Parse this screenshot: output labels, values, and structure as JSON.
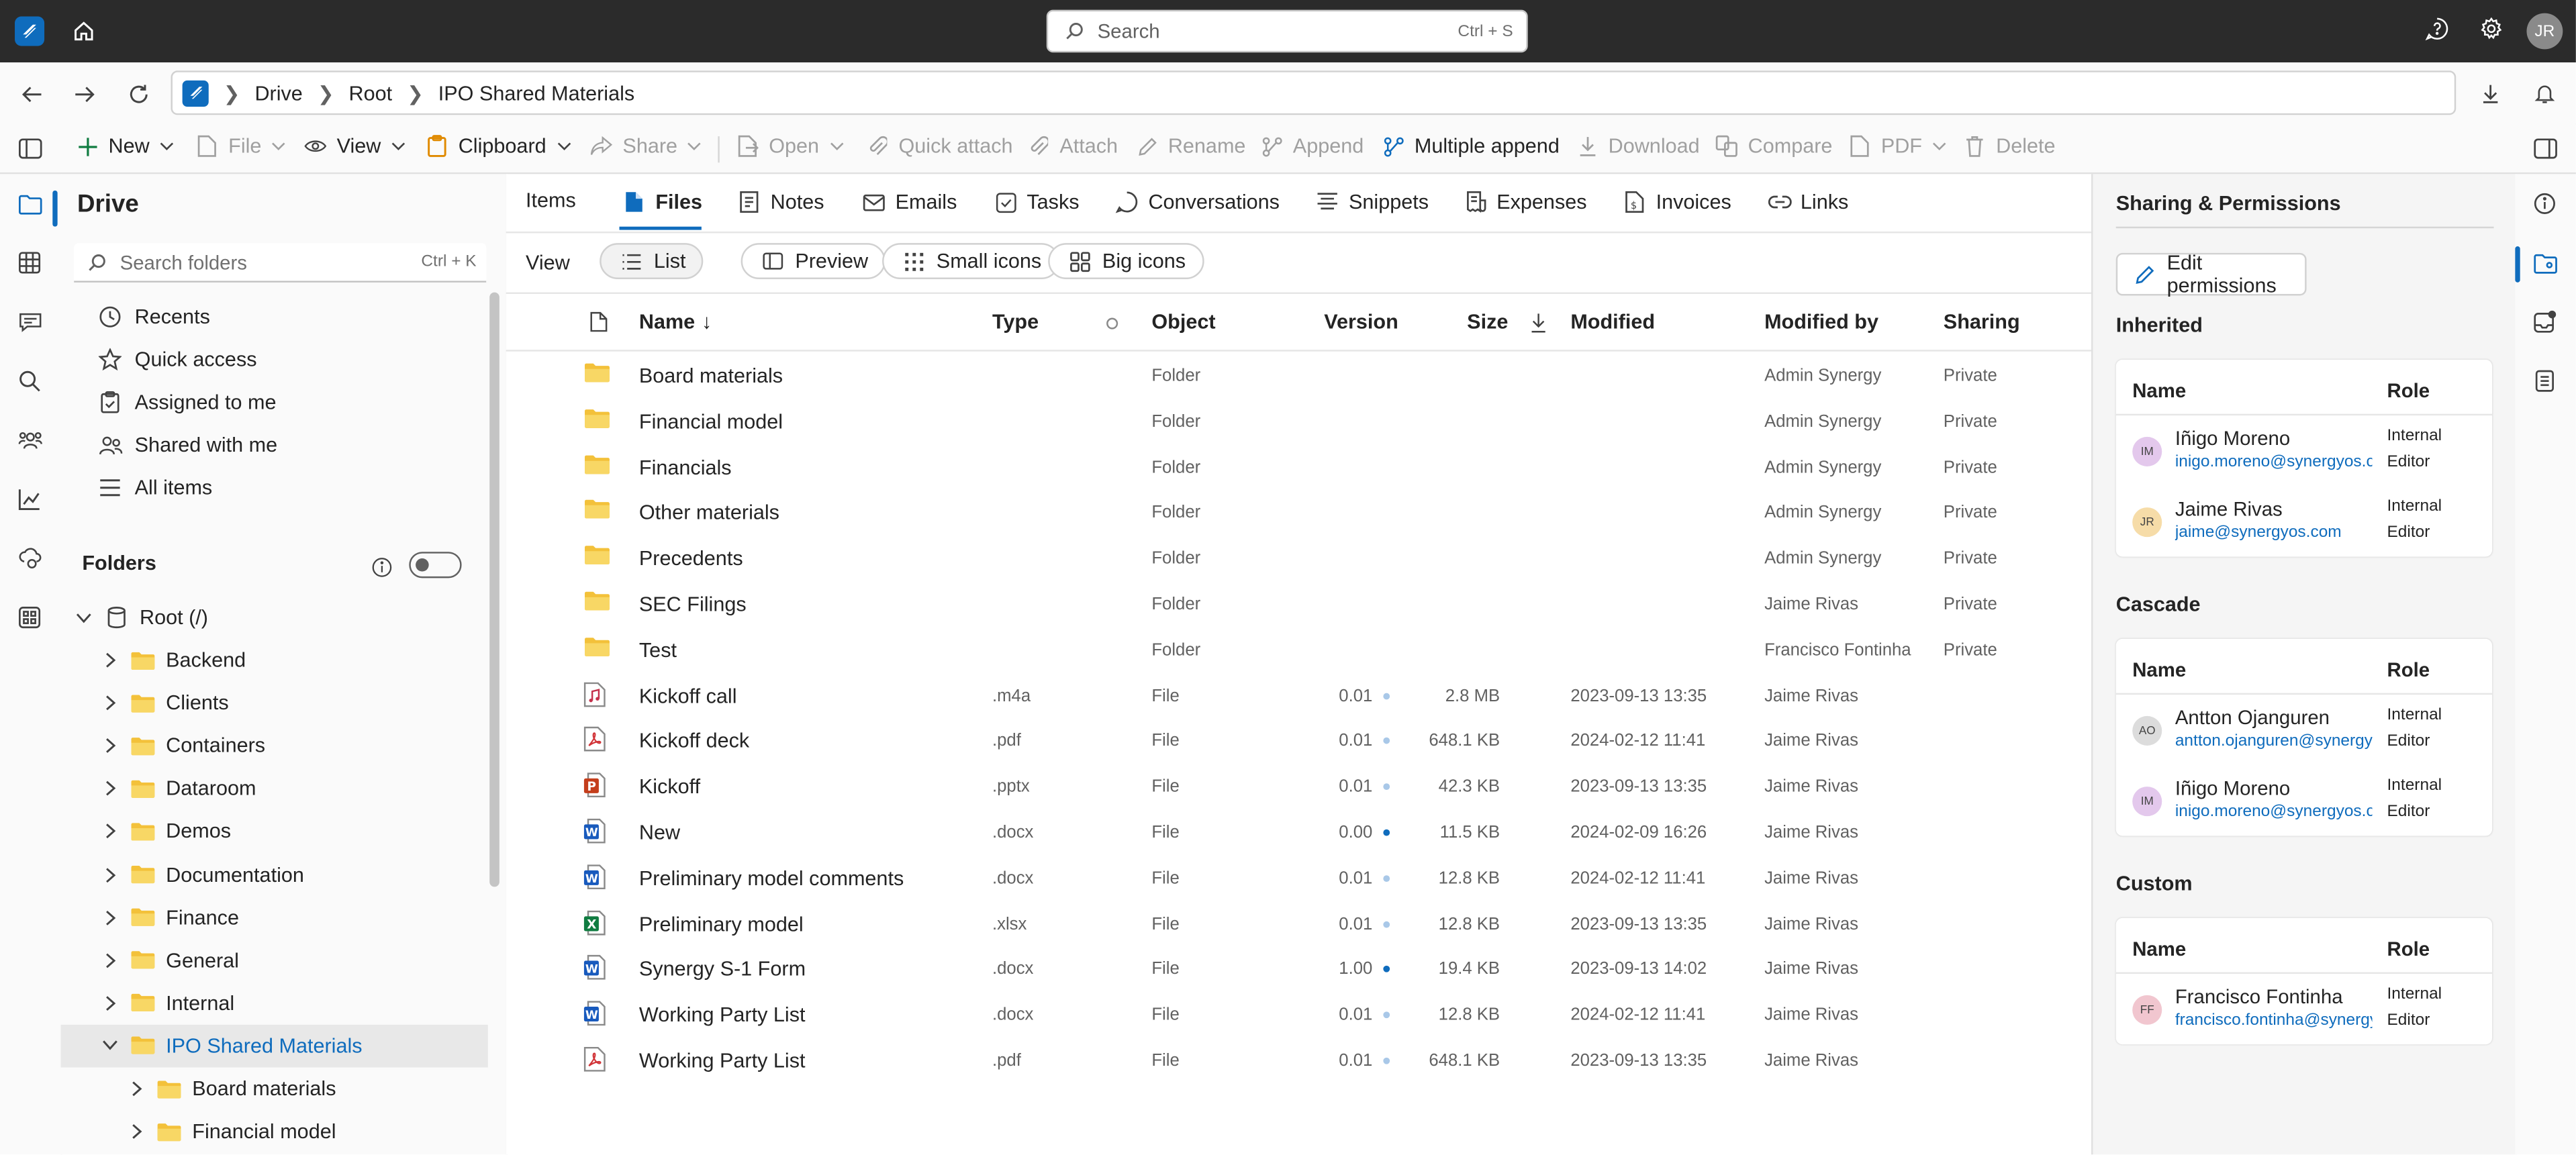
{
  "topbar": {
    "search_placeholder": "Search",
    "search_shortcut": "Ctrl + S",
    "avatar_initials": "JR"
  },
  "breadcrumb": [
    "Drive",
    "Root",
    "IPO Shared Materials"
  ],
  "toolbar": {
    "new": "New",
    "file": "File",
    "view": "View",
    "clipboard": "Clipboard",
    "share": "Share",
    "open": "Open",
    "quick_attach": "Quick attach",
    "attach": "Attach",
    "rename": "Rename",
    "append": "Append",
    "multiple_append": "Multiple append",
    "download": "Download",
    "compare": "Compare",
    "pdf": "PDF",
    "delete": "Delete"
  },
  "sidebar": {
    "title": "Drive",
    "search_placeholder": "Search folders",
    "search_shortcut": "Ctrl + K",
    "quick_items": [
      "Recents",
      "Quick access",
      "Assigned to me",
      "Shared with me",
      "All items"
    ],
    "folders_label": "Folders",
    "tree": {
      "root": "Root (/)",
      "children": [
        "Backend",
        "Clients",
        "Containers",
        "Dataroom",
        "Demos",
        "Documentation",
        "Finance",
        "General",
        "Internal",
        "IPO Shared Materials"
      ],
      "selected": "IPO Shared Materials",
      "sub_children": [
        "Board materials",
        "Financial model"
      ]
    }
  },
  "tabs": [
    "Items",
    "Files",
    "Notes",
    "Emails",
    "Tasks",
    "Conversations",
    "Snippets",
    "Expenses",
    "Invoices",
    "Links"
  ],
  "view": {
    "label": "View",
    "options": [
      "List",
      "Preview",
      "Small icons",
      "Big icons"
    ],
    "selected": "List"
  },
  "table": {
    "columns": {
      "name": "Name",
      "type": "Type",
      "object": "Object",
      "version": "Version",
      "size": "Size",
      "modified": "Modified",
      "modified_by": "Modified by",
      "sharing": "Sharing"
    },
    "rows": [
      {
        "icon": "folder",
        "name": "Board materials",
        "type": "",
        "object": "Folder",
        "version": "",
        "size": "",
        "modified": "",
        "modified_by": "Admin Synergy",
        "sharing": "Private"
      },
      {
        "icon": "folder",
        "name": "Financial model",
        "type": "",
        "object": "Folder",
        "version": "",
        "size": "",
        "modified": "",
        "modified_by": "Admin Synergy",
        "sharing": "Private"
      },
      {
        "icon": "folder",
        "name": "Financials",
        "type": "",
        "object": "Folder",
        "version": "",
        "size": "",
        "modified": "",
        "modified_by": "Admin Synergy",
        "sharing": "Private"
      },
      {
        "icon": "folder",
        "name": "Other materials",
        "type": "",
        "object": "Folder",
        "version": "",
        "size": "",
        "modified": "",
        "modified_by": "Admin Synergy",
        "sharing": "Private"
      },
      {
        "icon": "folder",
        "name": "Precedents",
        "type": "",
        "object": "Folder",
        "version": "",
        "size": "",
        "modified": "",
        "modified_by": "Admin Synergy",
        "sharing": "Private"
      },
      {
        "icon": "folder",
        "name": "SEC Filings",
        "type": "",
        "object": "Folder",
        "version": "",
        "size": "",
        "modified": "",
        "modified_by": "Jaime Rivas",
        "sharing": "Private"
      },
      {
        "icon": "folder",
        "name": "Test",
        "type": "",
        "object": "Folder",
        "version": "",
        "size": "",
        "modified": "",
        "modified_by": "Francisco Fontinha",
        "sharing": "Private"
      },
      {
        "icon": "audio",
        "name": "Kickoff call",
        "type": ".m4a",
        "object": "File",
        "version": "0.01",
        "dot": "light",
        "size": "2.8 MB",
        "modified": "2023-09-13 13:35",
        "modified_by": "Jaime Rivas",
        "sharing": ""
      },
      {
        "icon": "pdf",
        "name": "Kickoff deck",
        "type": ".pdf",
        "object": "File",
        "version": "0.01",
        "dot": "light",
        "size": "648.1 KB",
        "modified": "2024-02-12 11:41",
        "modified_by": "Jaime Rivas",
        "sharing": ""
      },
      {
        "icon": "pptx",
        "name": "Kickoff",
        "type": ".pptx",
        "object": "File",
        "version": "0.01",
        "dot": "light",
        "size": "42.3 KB",
        "modified": "2023-09-13 13:35",
        "modified_by": "Jaime Rivas",
        "sharing": ""
      },
      {
        "icon": "docx",
        "name": "New",
        "type": ".docx",
        "object": "File",
        "version": "0.00",
        "dot": "dark",
        "size": "11.5 KB",
        "modified": "2024-02-09 16:26",
        "modified_by": "Jaime Rivas",
        "sharing": ""
      },
      {
        "icon": "docx",
        "name": "Preliminary model comments",
        "type": ".docx",
        "object": "File",
        "version": "0.01",
        "dot": "light",
        "size": "12.8 KB",
        "modified": "2024-02-12 11:41",
        "modified_by": "Jaime Rivas",
        "sharing": ""
      },
      {
        "icon": "xlsx",
        "name": "Preliminary model",
        "type": ".xlsx",
        "object": "File",
        "version": "0.01",
        "dot": "light",
        "size": "12.8 KB",
        "modified": "2023-09-13 13:35",
        "modified_by": "Jaime Rivas",
        "sharing": ""
      },
      {
        "icon": "docx",
        "name": "Synergy S-1 Form",
        "type": ".docx",
        "object": "File",
        "version": "1.00",
        "dot": "dark",
        "size": "19.4 KB",
        "modified": "2023-09-13 14:02",
        "modified_by": "Jaime Rivas",
        "sharing": ""
      },
      {
        "icon": "docx",
        "name": "Working Party List",
        "type": ".docx",
        "object": "File",
        "version": "0.01",
        "dot": "light",
        "size": "12.8 KB",
        "modified": "2024-02-12 11:41",
        "modified_by": "Jaime Rivas",
        "sharing": ""
      },
      {
        "icon": "pdf",
        "name": "Working Party List",
        "type": ".pdf",
        "object": "File",
        "version": "0.01",
        "dot": "light",
        "size": "648.1 KB",
        "modified": "2023-09-13 13:35",
        "modified_by": "Jaime Rivas",
        "sharing": ""
      }
    ]
  },
  "permissions": {
    "title": "Sharing & Permissions",
    "edit_button": "Edit permissions",
    "col_name": "Name",
    "col_role": "Role",
    "sections": [
      {
        "title": "Inherited",
        "people": [
          {
            "initials": "IM",
            "name": "Iñigo Moreno",
            "email": "inigo.moreno@synergyos.com",
            "role1": "Internal",
            "role2": "Editor",
            "color": "#e3c8ec"
          },
          {
            "initials": "JR",
            "name": "Jaime Rivas",
            "email": "jaime@synergyos.com",
            "role1": "Internal",
            "role2": "Editor",
            "color": "#f6dca8"
          }
        ]
      },
      {
        "title": "Cascade",
        "people": [
          {
            "initials": "AO",
            "name": "Antton Ojanguren",
            "email": "antton.ojanguren@synergyos.com",
            "role1": "Internal",
            "role2": "Editor",
            "color": "#dcdcdc"
          },
          {
            "initials": "IM",
            "name": "Iñigo Moreno",
            "email": "inigo.moreno@synergyos.com",
            "role1": "Internal",
            "role2": "Editor",
            "color": "#e3c8ec"
          }
        ]
      },
      {
        "title": "Custom",
        "people": [
          {
            "initials": "FF",
            "name": "Francisco Fontinha",
            "email": "francisco.fontinha@synergyos.com",
            "role1": "Internal",
            "role2": "Editor",
            "color": "#f1c6cf"
          }
        ]
      }
    ]
  },
  "colors": {
    "accent": "#0f6cbd",
    "topbar": "#2b2b2b",
    "folder": "#f3c13a",
    "word": "#185abd",
    "excel": "#107c41",
    "powerpoint": "#c43e1c",
    "pdf": "#d13438"
  }
}
